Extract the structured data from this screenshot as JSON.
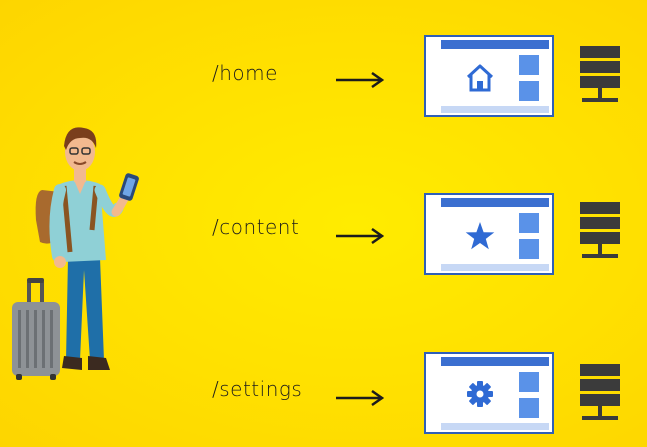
{
  "routes": [
    {
      "path": "/home",
      "icon": "home-icon"
    },
    {
      "path": "/content",
      "icon": "star-icon"
    },
    {
      "path": "/settings",
      "icon": "gear-icon"
    }
  ],
  "colors": {
    "background": "#ffe300",
    "page_border": "#2f5fb8",
    "page_header": "#3b6fd0",
    "page_side": "#5a92e8",
    "page_footer": "#c7d8f5",
    "icon": "#2f6ad4",
    "server": "#3b3b3b",
    "text": "#1c1c1c"
  }
}
